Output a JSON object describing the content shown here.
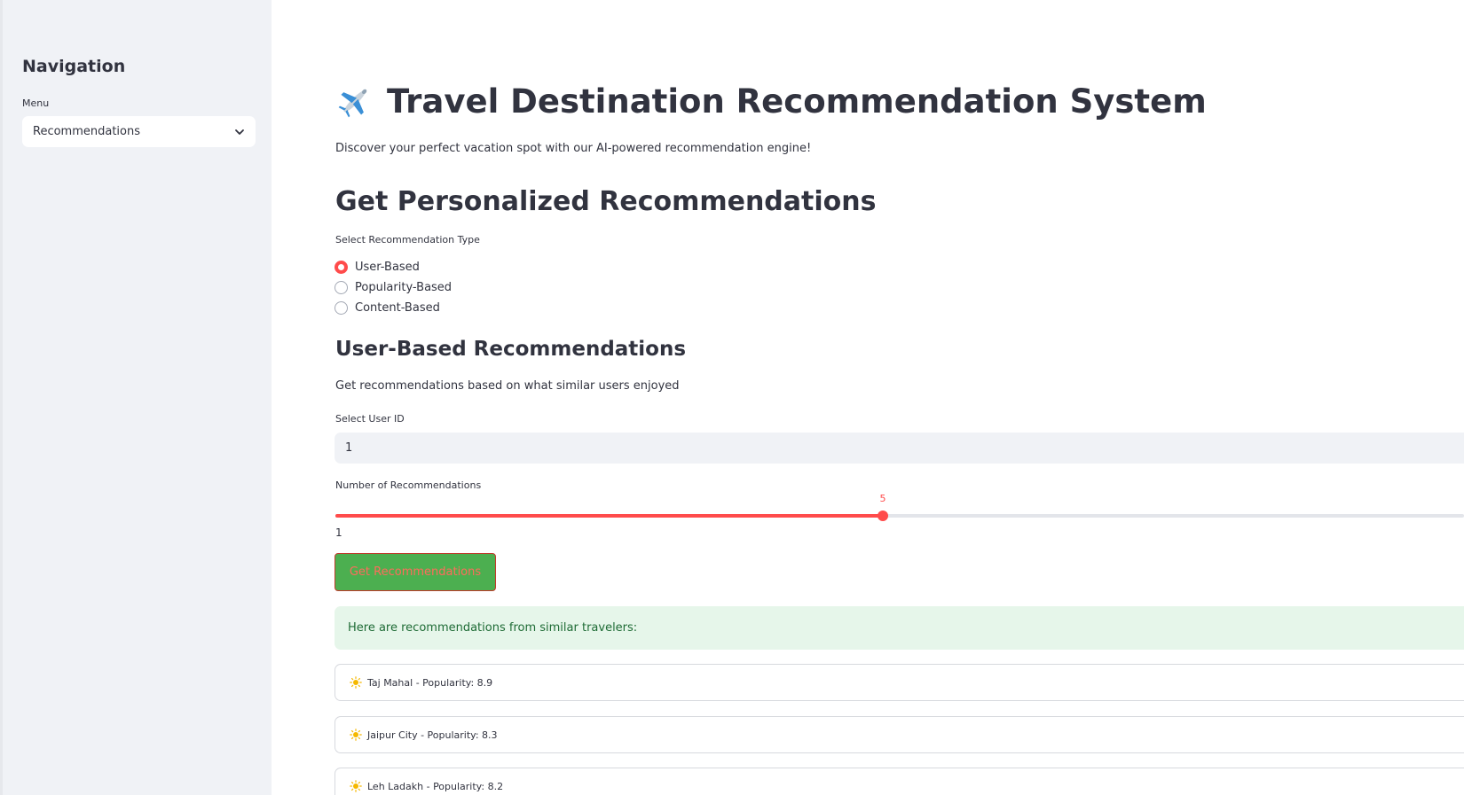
{
  "sidebar": {
    "title": "Navigation",
    "menu_label": "Menu",
    "menu_selected": "Recommendations"
  },
  "main": {
    "title": "Travel Destination Recommendation System",
    "title_icon": "airplane-icon",
    "subtitle": "Discover your perfect vacation spot with our AI-powered recommendation engine!",
    "section_title": "Get Personalized Recommendations",
    "rec_type_label": "Select Recommendation Type",
    "rec_types": [
      {
        "label": "User-Based",
        "selected": true
      },
      {
        "label": "Popularity-Based",
        "selected": false
      },
      {
        "label": "Content-Based",
        "selected": false
      }
    ],
    "subsection_title": "User-Based Recommendations",
    "subsection_desc": "Get recommendations based on what similar users enjoyed",
    "user_id_label": "Select User ID",
    "user_id_value": "1",
    "num_recs_label": "Number of Recommendations",
    "num_recs_value": "5",
    "num_recs_min": "1",
    "num_recs_fill_fraction": 0.485,
    "button_label": "Get Recommendations",
    "success_message": "Here are recommendations from similar travelers:",
    "recommendations": [
      {
        "icon": "sun-icon",
        "text": "Taj Mahal - Popularity: 8.9"
      },
      {
        "icon": "sun-icon",
        "text": "Jaipur City - Popularity: 8.3"
      },
      {
        "icon": "sun-icon",
        "text": "Leh Ladakh - Popularity: 8.2"
      }
    ]
  },
  "colors": {
    "accent": "#ff4b4b",
    "sidebar_bg": "#f0f2f6",
    "button_bg": "#4caf50",
    "success_bg": "#e6f6ea"
  }
}
